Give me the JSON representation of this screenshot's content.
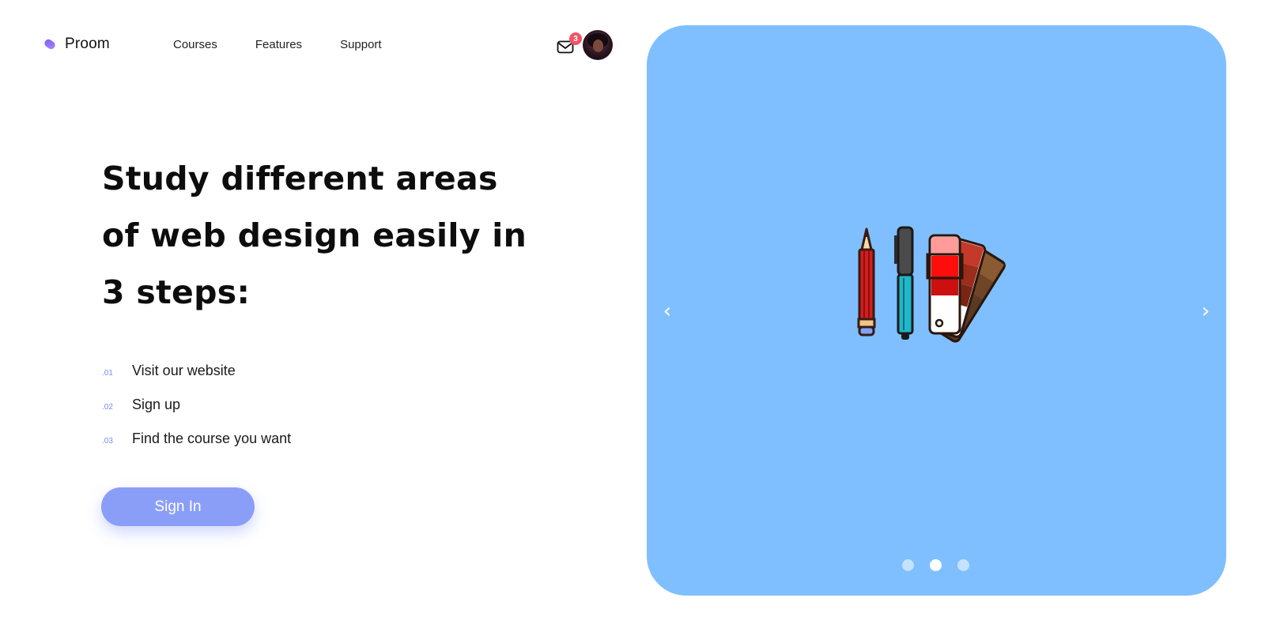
{
  "brand": {
    "name": "Proom"
  },
  "nav": {
    "items": [
      "Courses",
      "Features",
      "Support"
    ]
  },
  "notifications": {
    "count": "3"
  },
  "hero": {
    "headline_lines": [
      "Study different areas",
      "of web design easily in",
      "3 steps:"
    ],
    "steps": [
      {
        "num": ".01",
        "text": "Visit our website"
      },
      {
        "num": ".02",
        "text": "Sign up"
      },
      {
        "num": ".03",
        "text": "Find the course you want"
      }
    ],
    "cta": "Sign In"
  },
  "carousel": {
    "background": "#7fbfff",
    "slides": 3,
    "active_slide": 2,
    "illustration": "pencil-pen-color-swatches"
  },
  "colors": {
    "accent": "#8a9ef8",
    "step_number": "#7e8bf0",
    "badge": "#f25565"
  }
}
